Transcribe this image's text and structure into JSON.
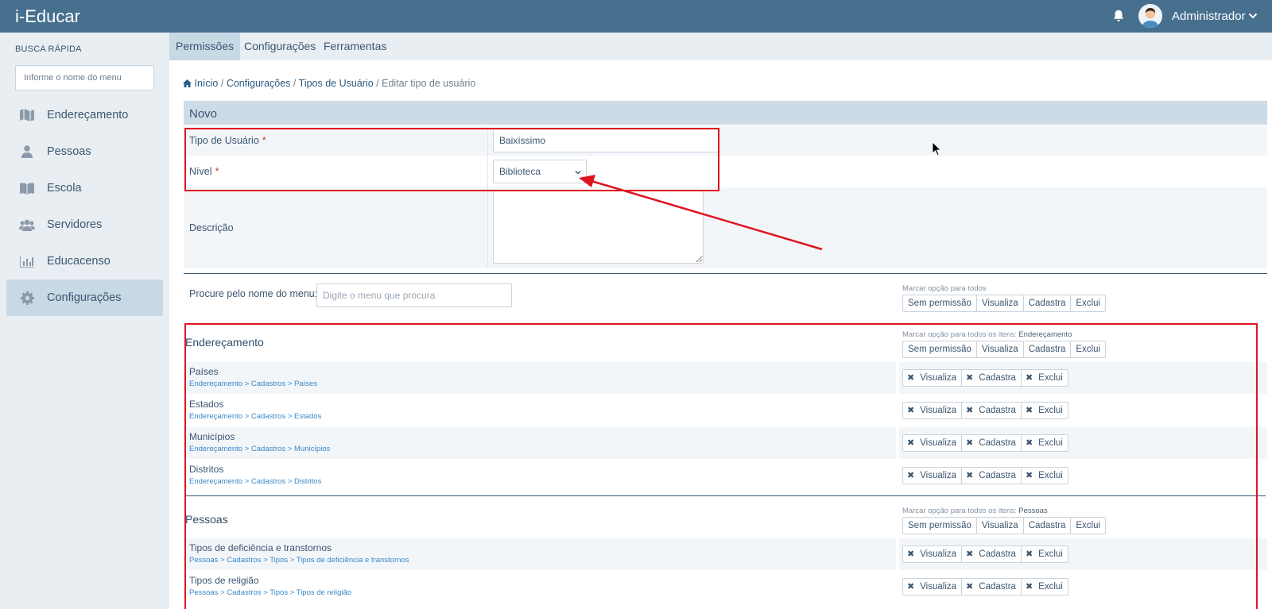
{
  "app": {
    "title": "i-Educar"
  },
  "topbar": {
    "user_name": "Administrador",
    "bell_icon": "bell-icon",
    "chevron_icon": "chevron-down-icon"
  },
  "sidebar": {
    "title": "BUSCA RÁPIDA",
    "search_placeholder": "Informe o nome do menu",
    "items": [
      {
        "label": "Endereçamento",
        "icon": "map-icon"
      },
      {
        "label": "Pessoas",
        "icon": "user-icon"
      },
      {
        "label": "Escola",
        "icon": "book-icon"
      },
      {
        "label": "Servidores",
        "icon": "users-icon"
      },
      {
        "label": "Educacenso",
        "icon": "bar-chart-icon"
      },
      {
        "label": "Configurações",
        "icon": "gear-icon",
        "active": true
      }
    ]
  },
  "tabs": [
    {
      "label": "Permissões",
      "active": true
    },
    {
      "label": "Configurações"
    },
    {
      "label": "Ferramentas"
    }
  ],
  "breadcrumb": {
    "home": "Início",
    "sep": "/",
    "level1": "Configurações",
    "level2": "Tipos de Usuário",
    "current": "Editar tipo de usuário"
  },
  "form": {
    "section_title": "Novo",
    "tipo_label": "Tipo de Usuário",
    "tipo_value": "Baixíssimo",
    "nivel_label": "Nível",
    "nivel_value": "Biblioteca",
    "descricao_label": "Descrição",
    "descricao_value": "",
    "required_mark": "*"
  },
  "permissions": {
    "search_label": "Procure pelo nome do menu:",
    "search_placeholder": "Digite o menu que procura",
    "mark_all_hint": "Marcar opção para todos",
    "mark_group_hint": "Marcar opção para todos os itens:",
    "options": [
      "Sem permissão",
      "Visualiza",
      "Cadastra",
      "Exclui"
    ],
    "row_buttons": [
      "Visualiza",
      "Cadastra",
      "Exclui"
    ],
    "x_glyph": "✖",
    "groups": [
      {
        "title": "Endereçamento",
        "items": [
          {
            "name": "Países",
            "path": "Endereçamento > Cadastros > Países"
          },
          {
            "name": "Estados",
            "path": "Endereçamento > Cadastros > Estados"
          },
          {
            "name": "Municípios",
            "path": "Endereçamento > Cadastros > Municípios"
          },
          {
            "name": "Distritos",
            "path": "Endereçamento > Cadastros > Distritos"
          }
        ]
      },
      {
        "title": "Pessoas",
        "items": [
          {
            "name": "Tipos de deficiência e transtornos",
            "path": "Pessoas > Cadastros > Tipos > Tipos de deficiência e transtornos"
          },
          {
            "name": "Tipos de religião",
            "path": "Pessoas > Cadastros > Tipos > Tipos de religião"
          }
        ]
      }
    ]
  },
  "annotations": {
    "highlight_color": "#e0141e"
  }
}
